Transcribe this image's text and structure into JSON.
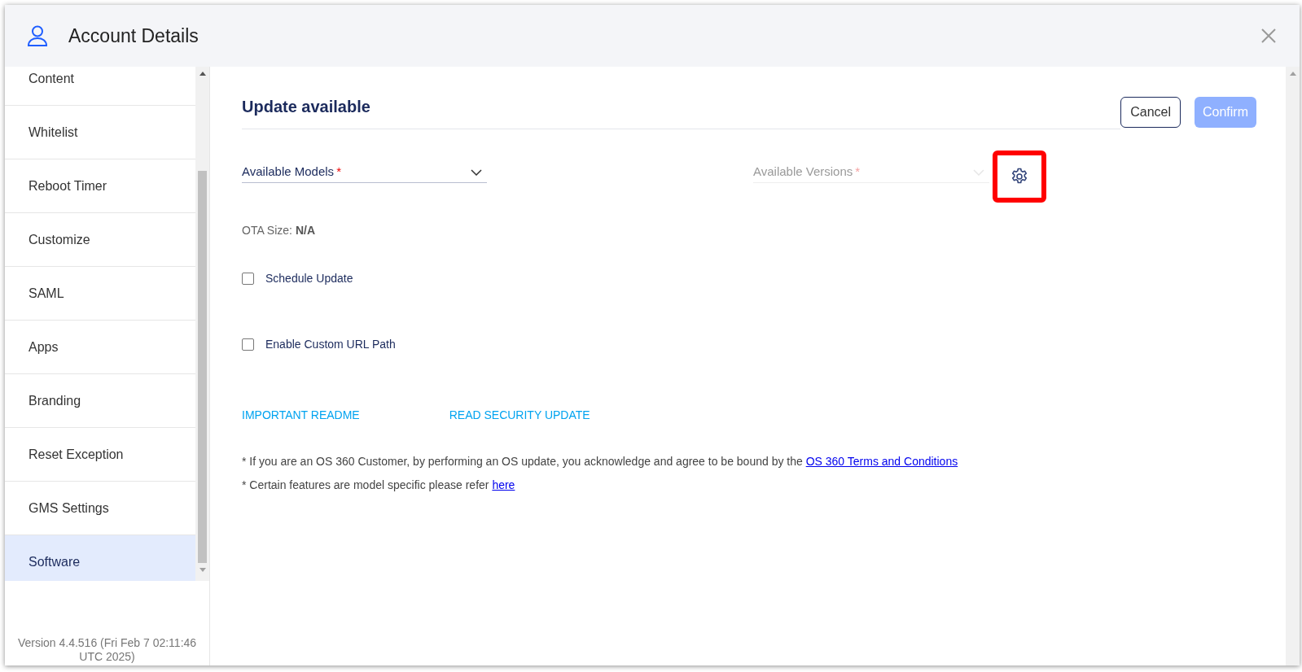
{
  "window": {
    "title": "Account Details"
  },
  "sidebar": {
    "items": [
      {
        "label": "Content",
        "selected": false
      },
      {
        "label": "Whitelist",
        "selected": false
      },
      {
        "label": "Reboot Timer",
        "selected": false
      },
      {
        "label": "Customize",
        "selected": false
      },
      {
        "label": "SAML",
        "selected": false
      },
      {
        "label": "Apps",
        "selected": false
      },
      {
        "label": "Branding",
        "selected": false
      },
      {
        "label": "Reset Exception",
        "selected": false
      },
      {
        "label": "GMS Settings",
        "selected": false
      },
      {
        "label": "Software",
        "selected": true
      }
    ],
    "version": "Version 4.4.516 (Fri Feb 7 02:11:46 UTC 2025)"
  },
  "main": {
    "title": "Update available",
    "buttons": [
      {
        "label": "Cancel",
        "kind": "outline",
        "disabled": false
      },
      {
        "label": "Confirm",
        "kind": "primary",
        "disabled": true
      }
    ],
    "selects": [
      {
        "label": "Available Models",
        "required_mark": "*",
        "disabled": false
      },
      {
        "label": "Available Versions",
        "required_mark": "*",
        "disabled": true
      }
    ],
    "settings_button": {
      "highlighted": true
    },
    "ota_size": {
      "label": "OTA Size:",
      "value": "N/A"
    },
    "checkboxes": [
      {
        "label": "Schedule Update",
        "checked": false
      },
      {
        "label": "Enable Custom URL Path",
        "checked": false
      }
    ],
    "links": [
      "IMPORTANT README",
      "READ SECURITY UPDATE"
    ],
    "footnotes": [
      {
        "text": "* If you are an OS 360 Customer, by performing an OS update, you acknowledge and agree to be bound by the ",
        "link": "OS 360 Terms and Conditions"
      },
      {
        "text": "* Certain features are model specific please refer ",
        "link": "here"
      }
    ]
  }
}
